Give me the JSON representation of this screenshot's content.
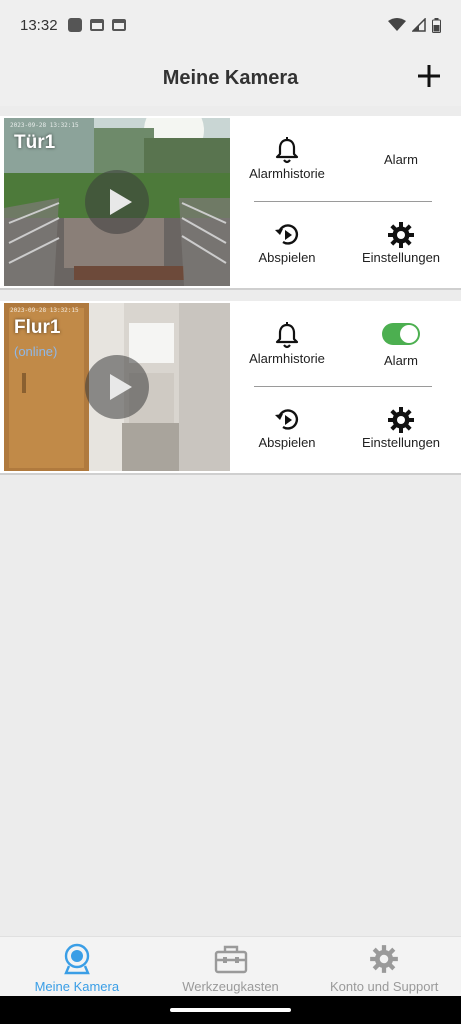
{
  "status_bar": {
    "time": "13:32"
  },
  "header": {
    "title": "Meine Kamera"
  },
  "cameras": [
    {
      "name": "Tür1",
      "status": "",
      "timestamp": "2023-09-28 13:32:15",
      "alarm_enabled": null,
      "actions": {
        "history": "Alarmhistorie",
        "alarm": "Alarm",
        "play": "Abspielen",
        "settings": "Einstellungen"
      }
    },
    {
      "name": "Flur1",
      "status": "(online)",
      "timestamp": "2023-09-28 13:32:15",
      "alarm_enabled": true,
      "actions": {
        "history": "Alarmhistorie",
        "alarm": "Alarm",
        "play": "Abspielen",
        "settings": "Einstellungen"
      }
    }
  ],
  "bottom_nav": {
    "items": [
      {
        "label": "Meine Kamera",
        "icon": "webcam-icon",
        "active": true
      },
      {
        "label": "Werkzeugkasten",
        "icon": "toolbox-icon",
        "active": false
      },
      {
        "label": "Konto und Support",
        "icon": "gear-icon",
        "active": false
      }
    ]
  },
  "colors": {
    "accent": "#3a9ee6",
    "toggle_on": "#4caf50",
    "status_online": "#8fb8e8"
  }
}
